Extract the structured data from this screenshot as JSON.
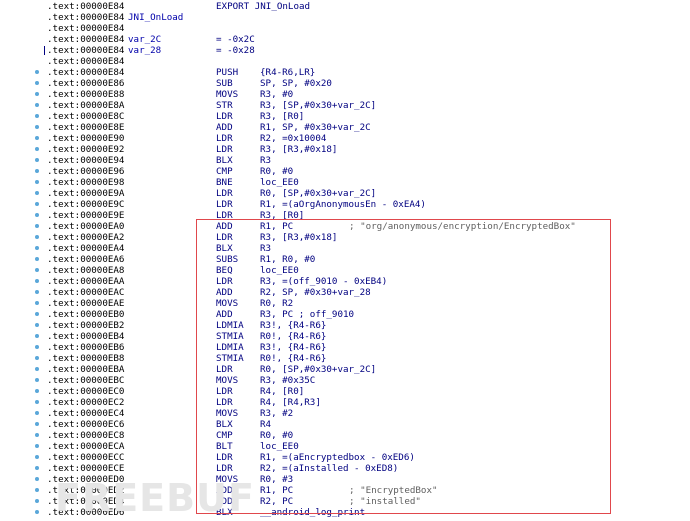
{
  "listing": {
    "rows": [
      {
        "addr": ".text:00000E84",
        "mnemonic": "EXPORT JNI_OnLoad",
        "operands": "",
        "comment": "",
        "symbol": "",
        "assign": "",
        "dot": false,
        "tick": false
      },
      {
        "addr": ".text:00000E84",
        "mnemonic": "",
        "operands": "",
        "comment": "",
        "symbol": "JNI_OnLoad",
        "assign": "",
        "dot": false,
        "tick": false
      },
      {
        "addr": ".text:00000E84",
        "mnemonic": "",
        "operands": "",
        "comment": "",
        "symbol": "",
        "assign": "",
        "dot": false,
        "tick": false
      },
      {
        "addr": ".text:00000E84",
        "mnemonic": "",
        "operands": "",
        "comment": "",
        "symbol": "var_2C",
        "assign": "= -0x2C",
        "dot": false,
        "tick": false
      },
      {
        "addr": ".text:00000E84",
        "mnemonic": "",
        "operands": "",
        "comment": "",
        "symbol": "var_28",
        "assign": "= -0x28",
        "dot": false,
        "tick": true
      },
      {
        "addr": ".text:00000E84",
        "mnemonic": "",
        "operands": "",
        "comment": "",
        "symbol": "",
        "assign": "",
        "dot": false,
        "tick": false
      },
      {
        "addr": ".text:00000E84",
        "mnemonic": "PUSH",
        "operands": "{R4-R6,LR}",
        "comment": "",
        "symbol": "",
        "assign": "",
        "dot": true,
        "tick": false
      },
      {
        "addr": ".text:00000E86",
        "mnemonic": "SUB",
        "operands": "SP, SP, #0x20",
        "comment": "",
        "symbol": "",
        "assign": "",
        "dot": true,
        "tick": false
      },
      {
        "addr": ".text:00000E88",
        "mnemonic": "MOVS",
        "operands": "R3, #0",
        "comment": "",
        "symbol": "",
        "assign": "",
        "dot": true,
        "tick": false
      },
      {
        "addr": ".text:00000E8A",
        "mnemonic": "STR",
        "operands": "R3, [SP,#0x30+var_2C]",
        "comment": "",
        "symbol": "",
        "assign": "",
        "dot": true,
        "tick": false
      },
      {
        "addr": ".text:00000E8C",
        "mnemonic": "LDR",
        "operands": "R3, [R0]",
        "comment": "",
        "symbol": "",
        "assign": "",
        "dot": true,
        "tick": false
      },
      {
        "addr": ".text:00000E8E",
        "mnemonic": "ADD",
        "operands": "R1, SP, #0x30+var_2C",
        "comment": "",
        "symbol": "",
        "assign": "",
        "dot": true,
        "tick": false
      },
      {
        "addr": ".text:00000E90",
        "mnemonic": "LDR",
        "operands": "R2, =0x10004",
        "comment": "",
        "symbol": "",
        "assign": "",
        "dot": true,
        "tick": false
      },
      {
        "addr": ".text:00000E92",
        "mnemonic": "LDR",
        "operands": "R3, [R3,#0x18]",
        "comment": "",
        "symbol": "",
        "assign": "",
        "dot": true,
        "tick": false
      },
      {
        "addr": ".text:00000E94",
        "mnemonic": "BLX",
        "operands": "R3",
        "comment": "",
        "symbol": "",
        "assign": "",
        "dot": true,
        "tick": false
      },
      {
        "addr": ".text:00000E96",
        "mnemonic": "CMP",
        "operands": "R0, #0",
        "comment": "",
        "symbol": "",
        "assign": "",
        "dot": true,
        "tick": false
      },
      {
        "addr": ".text:00000E98",
        "mnemonic": "BNE",
        "operands": "loc_EE0",
        "comment": "",
        "symbol": "",
        "assign": "",
        "dot": true,
        "tick": false
      },
      {
        "addr": ".text:00000E9A",
        "mnemonic": "LDR",
        "operands": "R0, [SP,#0x30+var_2C]",
        "comment": "",
        "symbol": "",
        "assign": "",
        "dot": true,
        "tick": false
      },
      {
        "addr": ".text:00000E9C",
        "mnemonic": "LDR",
        "operands": "R1, =(aOrgAnonymousEn - 0xEA4)",
        "comment": "",
        "symbol": "",
        "assign": "",
        "dot": true,
        "tick": false
      },
      {
        "addr": ".text:00000E9E",
        "mnemonic": "LDR",
        "operands": "R3, [R0]",
        "comment": "",
        "symbol": "",
        "assign": "",
        "dot": true,
        "tick": false
      },
      {
        "addr": ".text:00000EA0",
        "mnemonic": "ADD",
        "operands": "R1, PC",
        "comment": "; \"org/anonymous/encryption/EncryptedBox\"",
        "symbol": "",
        "assign": "",
        "dot": true,
        "tick": false
      },
      {
        "addr": ".text:00000EA2",
        "mnemonic": "LDR",
        "operands": "R3, [R3,#0x18]",
        "comment": "",
        "symbol": "",
        "assign": "",
        "dot": true,
        "tick": false
      },
      {
        "addr": ".text:00000EA4",
        "mnemonic": "BLX",
        "operands": "R3",
        "comment": "",
        "symbol": "",
        "assign": "",
        "dot": true,
        "tick": false
      },
      {
        "addr": ".text:00000EA6",
        "mnemonic": "SUBS",
        "operands": "R1, R0, #0",
        "comment": "",
        "symbol": "",
        "assign": "",
        "dot": true,
        "tick": false
      },
      {
        "addr": ".text:00000EA8",
        "mnemonic": "BEQ",
        "operands": "loc_EE0",
        "comment": "",
        "symbol": "",
        "assign": "",
        "dot": true,
        "tick": false
      },
      {
        "addr": ".text:00000EAA",
        "mnemonic": "LDR",
        "operands": "R3, =(off_9010 - 0xEB4)",
        "comment": "",
        "symbol": "",
        "assign": "",
        "dot": true,
        "tick": false
      },
      {
        "addr": ".text:00000EAC",
        "mnemonic": "ADD",
        "operands": "R2, SP, #0x30+var_28",
        "comment": "",
        "symbol": "",
        "assign": "",
        "dot": true,
        "tick": false
      },
      {
        "addr": ".text:00000EAE",
        "mnemonic": "MOVS",
        "operands": "R0, R2",
        "comment": "",
        "symbol": "",
        "assign": "",
        "dot": true,
        "tick": false
      },
      {
        "addr": ".text:00000EB0",
        "mnemonic": "ADD",
        "operands": "R3, PC ; off_9010",
        "comment": "",
        "symbol": "",
        "assign": "",
        "dot": true,
        "tick": false
      },
      {
        "addr": ".text:00000EB2",
        "mnemonic": "LDMIA",
        "operands": "R3!, {R4-R6}",
        "comment": "",
        "symbol": "",
        "assign": "",
        "dot": true,
        "tick": false
      },
      {
        "addr": ".text:00000EB4",
        "mnemonic": "STMIA",
        "operands": "R0!, {R4-R6}",
        "comment": "",
        "symbol": "",
        "assign": "",
        "dot": true,
        "tick": false
      },
      {
        "addr": ".text:00000EB6",
        "mnemonic": "LDMIA",
        "operands": "R3!, {R4-R6}",
        "comment": "",
        "symbol": "",
        "assign": "",
        "dot": true,
        "tick": false
      },
      {
        "addr": ".text:00000EB8",
        "mnemonic": "STMIA",
        "operands": "R0!, {R4-R6}",
        "comment": "",
        "symbol": "",
        "assign": "",
        "dot": true,
        "tick": false
      },
      {
        "addr": ".text:00000EBA",
        "mnemonic": "LDR",
        "operands": "R0, [SP,#0x30+var_2C]",
        "comment": "",
        "symbol": "",
        "assign": "",
        "dot": true,
        "tick": false
      },
      {
        "addr": ".text:00000EBC",
        "mnemonic": "MOVS",
        "operands": "R3, #0x35C",
        "comment": "",
        "symbol": "",
        "assign": "",
        "dot": true,
        "tick": false
      },
      {
        "addr": ".text:00000EC0",
        "mnemonic": "LDR",
        "operands": "R4, [R0]",
        "comment": "",
        "symbol": "",
        "assign": "",
        "dot": true,
        "tick": false
      },
      {
        "addr": ".text:00000EC2",
        "mnemonic": "LDR",
        "operands": "R4, [R4,R3]",
        "comment": "",
        "symbol": "",
        "assign": "",
        "dot": true,
        "tick": false
      },
      {
        "addr": ".text:00000EC4",
        "mnemonic": "MOVS",
        "operands": "R3, #2",
        "comment": "",
        "symbol": "",
        "assign": "",
        "dot": true,
        "tick": false
      },
      {
        "addr": ".text:00000EC6",
        "mnemonic": "BLX",
        "operands": "R4",
        "comment": "",
        "symbol": "",
        "assign": "",
        "dot": true,
        "tick": false
      },
      {
        "addr": ".text:00000EC8",
        "mnemonic": "CMP",
        "operands": "R0, #0",
        "comment": "",
        "symbol": "",
        "assign": "",
        "dot": true,
        "tick": false
      },
      {
        "addr": ".text:00000ECA",
        "mnemonic": "BLT",
        "operands": "loc_EE0",
        "comment": "",
        "symbol": "",
        "assign": "",
        "dot": true,
        "tick": false
      },
      {
        "addr": ".text:00000ECC",
        "mnemonic": "LDR",
        "operands": "R1, =(aEncryptedbox - 0xED6)",
        "comment": "",
        "symbol": "",
        "assign": "",
        "dot": true,
        "tick": false
      },
      {
        "addr": ".text:00000ECE",
        "mnemonic": "LDR",
        "operands": "R2, =(aInstalled - 0xED8)",
        "comment": "",
        "symbol": "",
        "assign": "",
        "dot": true,
        "tick": false
      },
      {
        "addr": ".text:00000ED0",
        "mnemonic": "MOVS",
        "operands": "R0, #3",
        "comment": "",
        "symbol": "",
        "assign": "",
        "dot": true,
        "tick": false
      },
      {
        "addr": ".text:00000ED2",
        "mnemonic": "ADD",
        "operands": "R1, PC",
        "comment": "; \"EncryptedBox\"",
        "symbol": "",
        "assign": "",
        "dot": true,
        "tick": false
      },
      {
        "addr": ".text:00000ED4",
        "mnemonic": "ADD",
        "operands": "R2, PC",
        "comment": "; \"installed\"",
        "symbol": "",
        "assign": "",
        "dot": true,
        "tick": false
      },
      {
        "addr": ".text:00000ED6",
        "mnemonic": "BLX",
        "operands": "__android_log_print",
        "comment": "",
        "symbol": "",
        "assign": "",
        "dot": true,
        "tick": false
      }
    ]
  },
  "watermark": {
    "text": "FREEBUF"
  },
  "colors": {
    "highlight_box": "#e0474c",
    "dot": "#5aa7d9",
    "code": "#000080"
  }
}
